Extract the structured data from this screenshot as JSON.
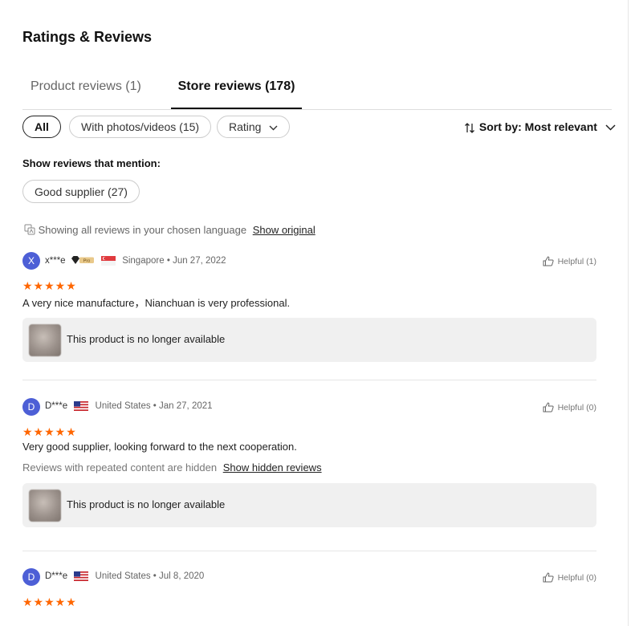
{
  "header": {
    "title": "Ratings & Reviews"
  },
  "tabs": [
    {
      "label": "Product reviews (1)"
    },
    {
      "label": "Store reviews (178)"
    }
  ],
  "filters": {
    "all": "All",
    "photos": "With photos/videos (15)",
    "rating": "Rating"
  },
  "sort": {
    "label": "Sort by: Most relevant"
  },
  "mentions": {
    "heading": "Show reviews that mention:",
    "tags": [
      "Good supplier (27)"
    ]
  },
  "language_note": {
    "text": "Showing all reviews in your chosen language",
    "link": "Show original"
  },
  "reviews": [
    {
      "initial": "X",
      "user": "x***e",
      "badge": "Pro",
      "country": "Singapore",
      "date": "Jun 27, 2022",
      "stars": "★★★★★",
      "text": "A very nice manufacture，Nianchuan is very professional.",
      "helpful": "Helpful (1)",
      "product": "This product is no longer available"
    },
    {
      "initial": "D",
      "user": "D***e",
      "country": "United States",
      "date": "Jan 27, 2021",
      "stars": "★★★★★",
      "text": "Very good supplier, looking forward to the next cooperation.",
      "helpful": "Helpful (0)",
      "hidden_note": "Reviews with repeated content are hidden",
      "hidden_link": "Show hidden reviews",
      "product": "This product is no longer available"
    },
    {
      "initial": "D",
      "user": "D***e",
      "country": "United States",
      "date": "Jul 8, 2020",
      "stars": "★★★★★",
      "helpful": "Helpful (0)"
    }
  ],
  "colors": {
    "star": "#ff6600",
    "avatar": "#4d5fd6",
    "card_bg": "#f0f0f0"
  },
  "icons": [
    "chevron-down-icon",
    "sort-icon",
    "translate-icon",
    "thumbs-up-icon",
    "pro-badge-icon",
    "singapore-flag-icon",
    "us-flag-icon"
  ]
}
